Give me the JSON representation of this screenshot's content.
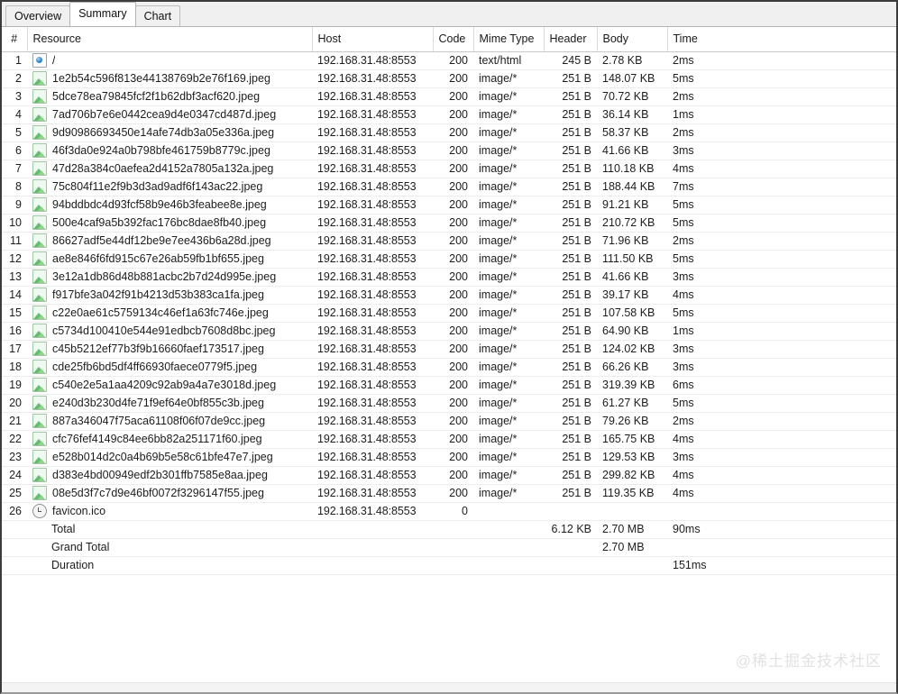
{
  "tabs": [
    {
      "label": "Overview",
      "active": false
    },
    {
      "label": "Summary",
      "active": true
    },
    {
      "label": "Chart",
      "active": false
    }
  ],
  "table": {
    "columns": [
      "#",
      "Resource",
      "Host",
      "Code",
      "Mime Type",
      "Header",
      "Body",
      "Time"
    ],
    "rows": [
      {
        "n": "1",
        "icon": "page-icon",
        "resource": "/",
        "host": "192.168.31.48:8553",
        "code": "200",
        "mime": "text/html",
        "header": "245 B",
        "body": "2.78 KB",
        "time": "2ms"
      },
      {
        "n": "2",
        "icon": "image-icon",
        "resource": "1e2b54c596f813e44138769b2e76f169.jpeg",
        "host": "192.168.31.48:8553",
        "code": "200",
        "mime": "image/*",
        "header": "251 B",
        "body": "148.07 KB",
        "time": "5ms"
      },
      {
        "n": "3",
        "icon": "image-icon",
        "resource": "5dce78ea79845fcf2f1b62dbf3acf620.jpeg",
        "host": "192.168.31.48:8553",
        "code": "200",
        "mime": "image/*",
        "header": "251 B",
        "body": "70.72 KB",
        "time": "2ms"
      },
      {
        "n": "4",
        "icon": "image-icon",
        "resource": "7ad706b7e6e0442cea9d4e0347cd487d.jpeg",
        "host": "192.168.31.48:8553",
        "code": "200",
        "mime": "image/*",
        "header": "251 B",
        "body": "36.14 KB",
        "time": "1ms"
      },
      {
        "n": "5",
        "icon": "image-icon",
        "resource": "9d90986693450e14afe74db3a05e336a.jpeg",
        "host": "192.168.31.48:8553",
        "code": "200",
        "mime": "image/*",
        "header": "251 B",
        "body": "58.37 KB",
        "time": "2ms"
      },
      {
        "n": "6",
        "icon": "image-icon",
        "resource": "46f3da0e924a0b798bfe461759b8779c.jpeg",
        "host": "192.168.31.48:8553",
        "code": "200",
        "mime": "image/*",
        "header": "251 B",
        "body": "41.66 KB",
        "time": "3ms"
      },
      {
        "n": "7",
        "icon": "image-icon",
        "resource": "47d28a384c0aefea2d4152a7805a132a.jpeg",
        "host": "192.168.31.48:8553",
        "code": "200",
        "mime": "image/*",
        "header": "251 B",
        "body": "110.18 KB",
        "time": "4ms"
      },
      {
        "n": "8",
        "icon": "image-icon",
        "resource": "75c804f11e2f9b3d3ad9adf6f143ac22.jpeg",
        "host": "192.168.31.48:8553",
        "code": "200",
        "mime": "image/*",
        "header": "251 B",
        "body": "188.44 KB",
        "time": "7ms"
      },
      {
        "n": "9",
        "icon": "image-icon",
        "resource": "94bddbdc4d93fcf58b9e46b3feabee8e.jpeg",
        "host": "192.168.31.48:8553",
        "code": "200",
        "mime": "image/*",
        "header": "251 B",
        "body": "91.21 KB",
        "time": "5ms"
      },
      {
        "n": "10",
        "icon": "image-icon",
        "resource": "500e4caf9a5b392fac176bc8dae8fb40.jpeg",
        "host": "192.168.31.48:8553",
        "code": "200",
        "mime": "image/*",
        "header": "251 B",
        "body": "210.72 KB",
        "time": "5ms"
      },
      {
        "n": "11",
        "icon": "image-icon",
        "resource": "86627adf5e44df12be9e7ee436b6a28d.jpeg",
        "host": "192.168.31.48:8553",
        "code": "200",
        "mime": "image/*",
        "header": "251 B",
        "body": "71.96 KB",
        "time": "2ms"
      },
      {
        "n": "12",
        "icon": "image-icon",
        "resource": "ae8e846f6fd915c67e26ab59fb1bf655.jpeg",
        "host": "192.168.31.48:8553",
        "code": "200",
        "mime": "image/*",
        "header": "251 B",
        "body": "111.50 KB",
        "time": "5ms"
      },
      {
        "n": "13",
        "icon": "image-icon",
        "resource": "3e12a1db86d48b881acbc2b7d24d995e.jpeg",
        "host": "192.168.31.48:8553",
        "code": "200",
        "mime": "image/*",
        "header": "251 B",
        "body": "41.66 KB",
        "time": "3ms"
      },
      {
        "n": "14",
        "icon": "image-icon",
        "resource": "f917bfe3a042f91b4213d53b383ca1fa.jpeg",
        "host": "192.168.31.48:8553",
        "code": "200",
        "mime": "image/*",
        "header": "251 B",
        "body": "39.17 KB",
        "time": "4ms"
      },
      {
        "n": "15",
        "icon": "image-icon",
        "resource": "c22e0ae61c5759134c46ef1a63fc746e.jpeg",
        "host": "192.168.31.48:8553",
        "code": "200",
        "mime": "image/*",
        "header": "251 B",
        "body": "107.58 KB",
        "time": "5ms"
      },
      {
        "n": "16",
        "icon": "image-icon",
        "resource": "c5734d100410e544e91edbcb7608d8bc.jpeg",
        "host": "192.168.31.48:8553",
        "code": "200",
        "mime": "image/*",
        "header": "251 B",
        "body": "64.90 KB",
        "time": "1ms"
      },
      {
        "n": "17",
        "icon": "image-icon",
        "resource": "c45b5212ef77b3f9b16660faef173517.jpeg",
        "host": "192.168.31.48:8553",
        "code": "200",
        "mime": "image/*",
        "header": "251 B",
        "body": "124.02 KB",
        "time": "3ms"
      },
      {
        "n": "18",
        "icon": "image-icon",
        "resource": "cde25fb6bd5df4ff66930faece0779f5.jpeg",
        "host": "192.168.31.48:8553",
        "code": "200",
        "mime": "image/*",
        "header": "251 B",
        "body": "66.26 KB",
        "time": "3ms"
      },
      {
        "n": "19",
        "icon": "image-icon",
        "resource": "c540e2e5a1aa4209c92ab9a4a7e3018d.jpeg",
        "host": "192.168.31.48:8553",
        "code": "200",
        "mime": "image/*",
        "header": "251 B",
        "body": "319.39 KB",
        "time": "6ms"
      },
      {
        "n": "20",
        "icon": "image-icon",
        "resource": "e240d3b230d4fe71f9ef64e0bf855c3b.jpeg",
        "host": "192.168.31.48:8553",
        "code": "200",
        "mime": "image/*",
        "header": "251 B",
        "body": "61.27 KB",
        "time": "5ms"
      },
      {
        "n": "21",
        "icon": "image-icon",
        "resource": "887a346047f75aca61108f06f07de9cc.jpeg",
        "host": "192.168.31.48:8553",
        "code": "200",
        "mime": "image/*",
        "header": "251 B",
        "body": "79.26 KB",
        "time": "2ms"
      },
      {
        "n": "22",
        "icon": "image-icon",
        "resource": "cfc76fef4149c84ee6bb82a251171f60.jpeg",
        "host": "192.168.31.48:8553",
        "code": "200",
        "mime": "image/*",
        "header": "251 B",
        "body": "165.75 KB",
        "time": "4ms"
      },
      {
        "n": "23",
        "icon": "image-icon",
        "resource": "e528b014d2c0a4b69b5e58c61bfe47e7.jpeg",
        "host": "192.168.31.48:8553",
        "code": "200",
        "mime": "image/*",
        "header": "251 B",
        "body": "129.53 KB",
        "time": "3ms"
      },
      {
        "n": "24",
        "icon": "image-icon",
        "resource": "d383e4bd00949edf2b301ffb7585e8aa.jpeg",
        "host": "192.168.31.48:8553",
        "code": "200",
        "mime": "image/*",
        "header": "251 B",
        "body": "299.82 KB",
        "time": "4ms"
      },
      {
        "n": "25",
        "icon": "image-icon",
        "resource": "08e5d3f7c7d9e46bf0072f3296147f55.jpeg",
        "host": "192.168.31.48:8553",
        "code": "200",
        "mime": "image/*",
        "header": "251 B",
        "body": "119.35 KB",
        "time": "4ms"
      },
      {
        "n": "26",
        "icon": "favicon-icon",
        "resource": "favicon.ico",
        "host": "192.168.31.48:8553",
        "code": "0",
        "mime": "",
        "header": "",
        "body": "",
        "time": ""
      }
    ],
    "summary_rows": [
      {
        "n": "",
        "label": "Total",
        "host": "",
        "code": "",
        "mime": "",
        "header": "6.12 KB",
        "body": "2.70 MB",
        "time": "90ms"
      },
      {
        "n": "",
        "label": "Grand Total",
        "host": "",
        "code": "",
        "mime": "",
        "header": "",
        "body": "2.70 MB",
        "time": ""
      },
      {
        "n": "",
        "label": "Duration",
        "host": "",
        "code": "",
        "mime": "",
        "header": "",
        "body": "",
        "time": "151ms"
      }
    ]
  },
  "watermark": "@稀土掘金技术社区"
}
